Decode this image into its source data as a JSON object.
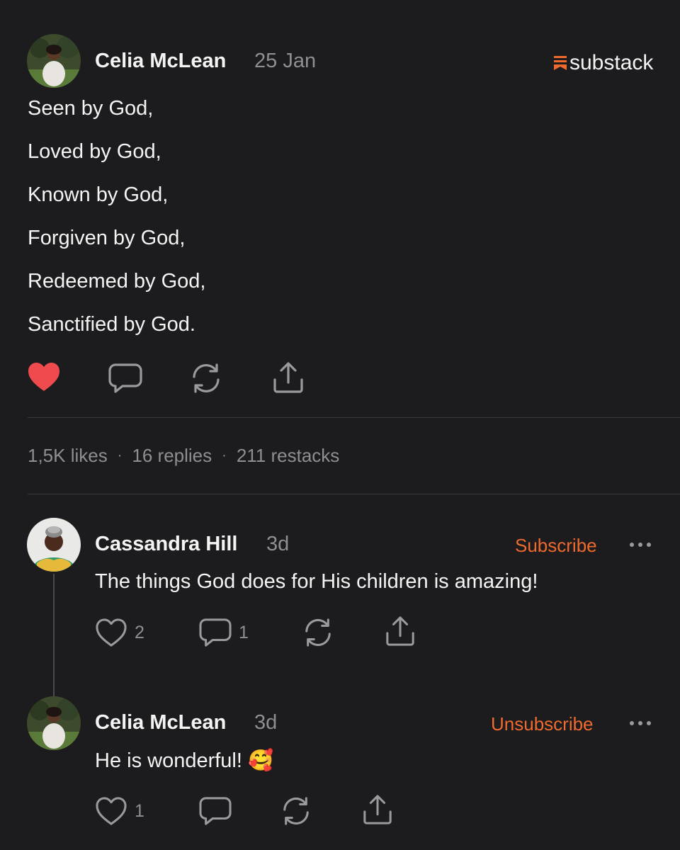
{
  "post": {
    "author": "Celia McLean",
    "date": "25 Jan",
    "brand": "substack",
    "lines": [
      "Seen by God,",
      "Loved by God,",
      "Known by God,",
      "Forgiven by God,",
      "Redeemed by God,",
      "Sanctified by God."
    ],
    "stats": {
      "likes": "1,5K likes",
      "replies": "16 replies",
      "restacks": "211 restacks",
      "separator": "·"
    }
  },
  "comments": [
    {
      "author": "Cassandra Hill",
      "time": "3d",
      "action": "Subscribe",
      "text": "The things God does for His children is amazing!",
      "likes": "2",
      "replies": "1"
    },
    {
      "author": "Celia McLean",
      "time": "3d",
      "action": "Unsubscribe",
      "text": "He is wonderful! 🥰",
      "likes": "1"
    }
  ],
  "colors": {
    "background": "#1c1b1d",
    "accent": "#ef6a2d",
    "heart_filled": "#ef4b4f",
    "muted": "#8e8e93"
  },
  "icons": [
    "heart-filled-icon",
    "comment-icon",
    "restack-icon",
    "share-icon",
    "heart-icon",
    "more-icon",
    "substack-logo-icon"
  ]
}
